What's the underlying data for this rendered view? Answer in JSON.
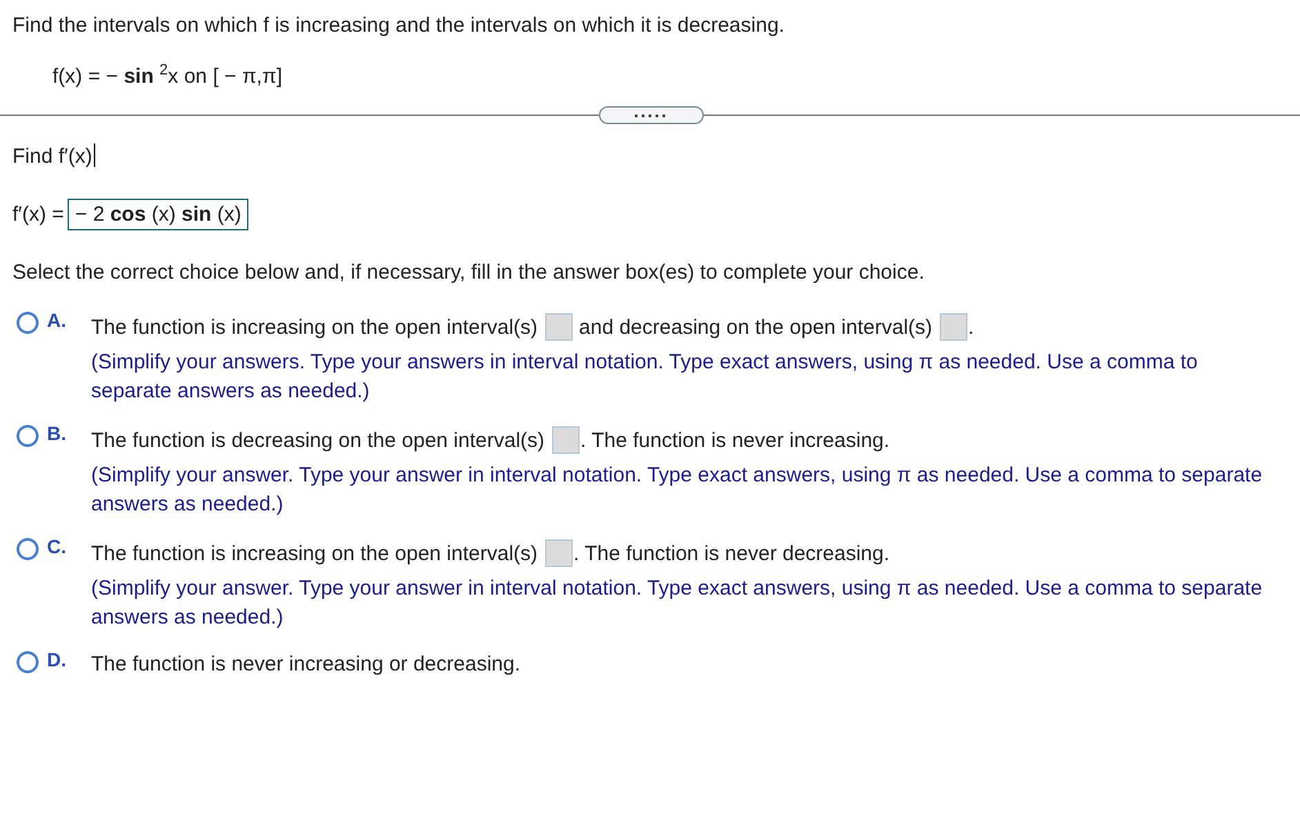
{
  "question": {
    "prompt": "Find the intervals on which f is increasing and the intervals on which it is decreasing.",
    "formula": "f(x) =  −  **sin** $^{2}$x on [ − π,π]"
  },
  "step": {
    "title": "Find f′(x)",
    "answer_label": "f′(x) =",
    "answer_value": "− 2 **cos** (x) **sin** (x)",
    "instruction": "Select the correct choice below and, if necessary, fill in the answer box(es) to complete your choice."
  },
  "choices": [
    {
      "letter": "A.",
      "selected": false,
      "parts": [
        {
          "kind": "text",
          "text": "The function is increasing on the open interval(s)"
        },
        {
          "kind": "box"
        },
        {
          "kind": "text",
          "text": "and decreasing on the open interval(s)"
        },
        {
          "kind": "box"
        },
        {
          "kind": "text",
          "text": "."
        }
      ],
      "hint": "(Simplify your answers. Type your answers in interval notation. Type exact answers, using π as needed. Use a comma to separate answers as needed.)"
    },
    {
      "letter": "B.",
      "selected": false,
      "parts": [
        {
          "kind": "text",
          "text": "The function is decreasing on the open interval(s)"
        },
        {
          "kind": "box"
        },
        {
          "kind": "text",
          "text": ". The function is never increasing."
        }
      ],
      "hint": "(Simplify your answer. Type your answer in interval notation. Type exact answers, using π as needed. Use a comma to separate answers as needed.)"
    },
    {
      "letter": "C.",
      "selected": false,
      "parts": [
        {
          "kind": "text",
          "text": "The function is increasing on the open interval(s)"
        },
        {
          "kind": "box"
        },
        {
          "kind": "text",
          "text": ". The function is never decreasing."
        }
      ],
      "hint": "(Simplify your answer. Type your answer in interval notation. Type exact answers, using π as needed. Use a comma to separate answers as needed.)"
    },
    {
      "letter": "D.",
      "selected": false,
      "parts": [
        {
          "kind": "text",
          "text": "The function is never increasing or decreasing."
        }
      ]
    }
  ]
}
